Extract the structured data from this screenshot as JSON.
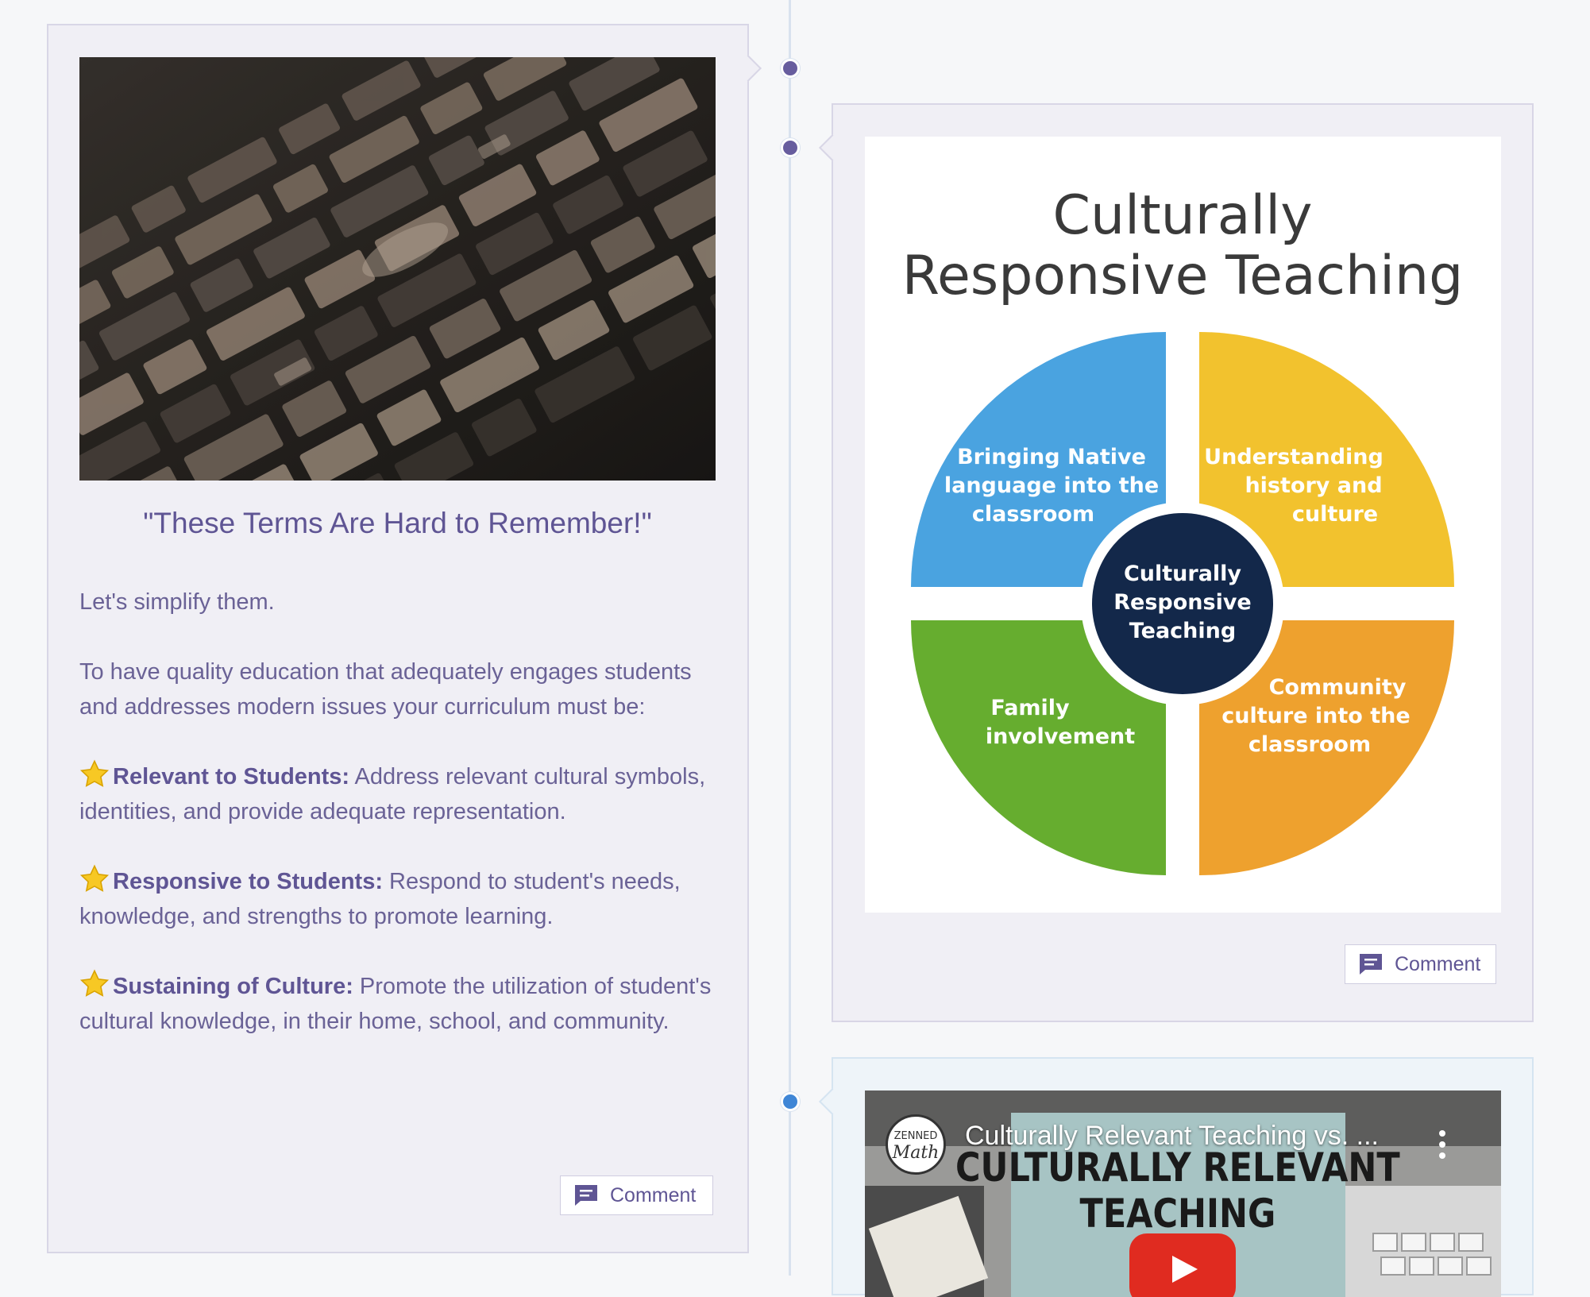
{
  "left_post": {
    "title": "\"These Terms Are Hard to Remember!\"",
    "intro": "Let's simplify them.",
    "paragraph": "To have quality education that adequately engages students and addresses modern issues your curriculum must be:",
    "points": [
      {
        "term": "Relevant to Students:",
        "text": " Address relevant cultural symbols, identities, and provide adequate representation."
      },
      {
        "term": "Responsive to Students:",
        "text": " Respond to student's needs, knowledge, and strengths to promote learning."
      },
      {
        "term": "Sustaining of Culture:",
        "text": " Promote the utilization of student's cultural knowledge, in their home, school, and community."
      }
    ],
    "comment_label": "Comment"
  },
  "infographic": {
    "title_line1": "Culturally",
    "title_line2": "Responsive Teaching",
    "center": [
      "Culturally",
      "Responsive",
      "Teaching"
    ],
    "quadrants": {
      "top_left": [
        "Bringing Native",
        "language into the",
        "classroom"
      ],
      "top_right": [
        "Understanding",
        "history and",
        "culture"
      ],
      "bottom_left": [
        "Family",
        "involvement"
      ],
      "bottom_right": [
        "Community",
        "culture into the",
        "classroom"
      ]
    },
    "colors": {
      "blue": "#4aa3e0",
      "yellow": "#f2c22e",
      "green": "#66ad2f",
      "orange": "#eea12e",
      "center": "#13284a"
    }
  },
  "right_post": {
    "comment_label": "Comment"
  },
  "video": {
    "title": "Culturally Relevant Teaching vs. ...",
    "thumb_line1": "CULTURALLY RELEVANT",
    "thumb_line2": "TEACHING",
    "channel_top": "ZENNED",
    "channel_bottom": "Math"
  },
  "timeline": {
    "dot_color": "#675d9e",
    "active_dot_color": "#3f86d6"
  }
}
